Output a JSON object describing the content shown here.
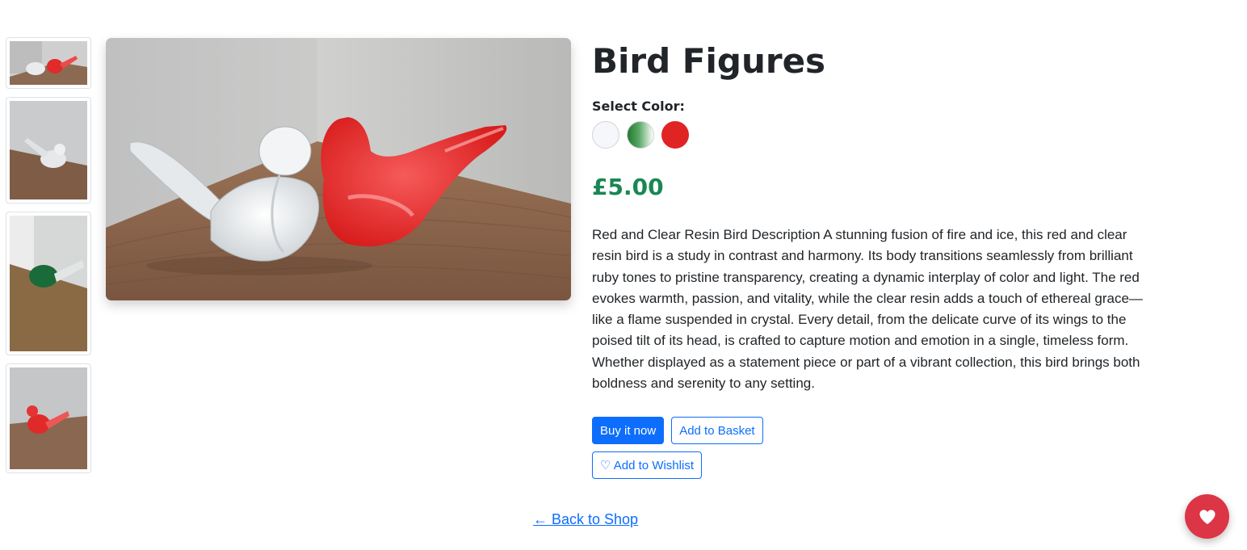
{
  "product": {
    "title": "Bird Figures",
    "select_color_label": "Select Color:",
    "colors": [
      {
        "name": "clear",
        "value": "#f5f7fb"
      },
      {
        "name": "green",
        "value": "#1f7a2e"
      },
      {
        "name": "red",
        "value": "#e02424"
      }
    ],
    "price": "£5.00",
    "description": "Red and Clear Resin Bird Description A stunning fusion of fire and ice, this red and clear resin bird is a study in contrast and harmony. Its body transitions seamlessly from brilliant ruby tones to pristine transparency, creating a dynamic interplay of color and light. The red evokes warmth, passion, and vitality, while the clear resin adds a touch of ethereal grace—like a flame suspended in crystal. Every detail, from the delicate curve of its wings to the poised tilt of its head, is crafted to capture motion and emotion in a single, timeless form. Whether displayed as a statement piece or part of a vibrant collection, this bird brings both boldness and serenity to any setting."
  },
  "actions": {
    "buy_now": "Buy it now",
    "add_to_basket": "Add to Basket",
    "add_to_wishlist": "♡ Add to Wishlist"
  },
  "nav": {
    "back_to_shop": "← Back to Shop"
  },
  "icons": {
    "fab": "heart-icon"
  },
  "colors": {
    "primary": "#0d6efd",
    "price": "#198754",
    "fab": "#dc3545"
  }
}
